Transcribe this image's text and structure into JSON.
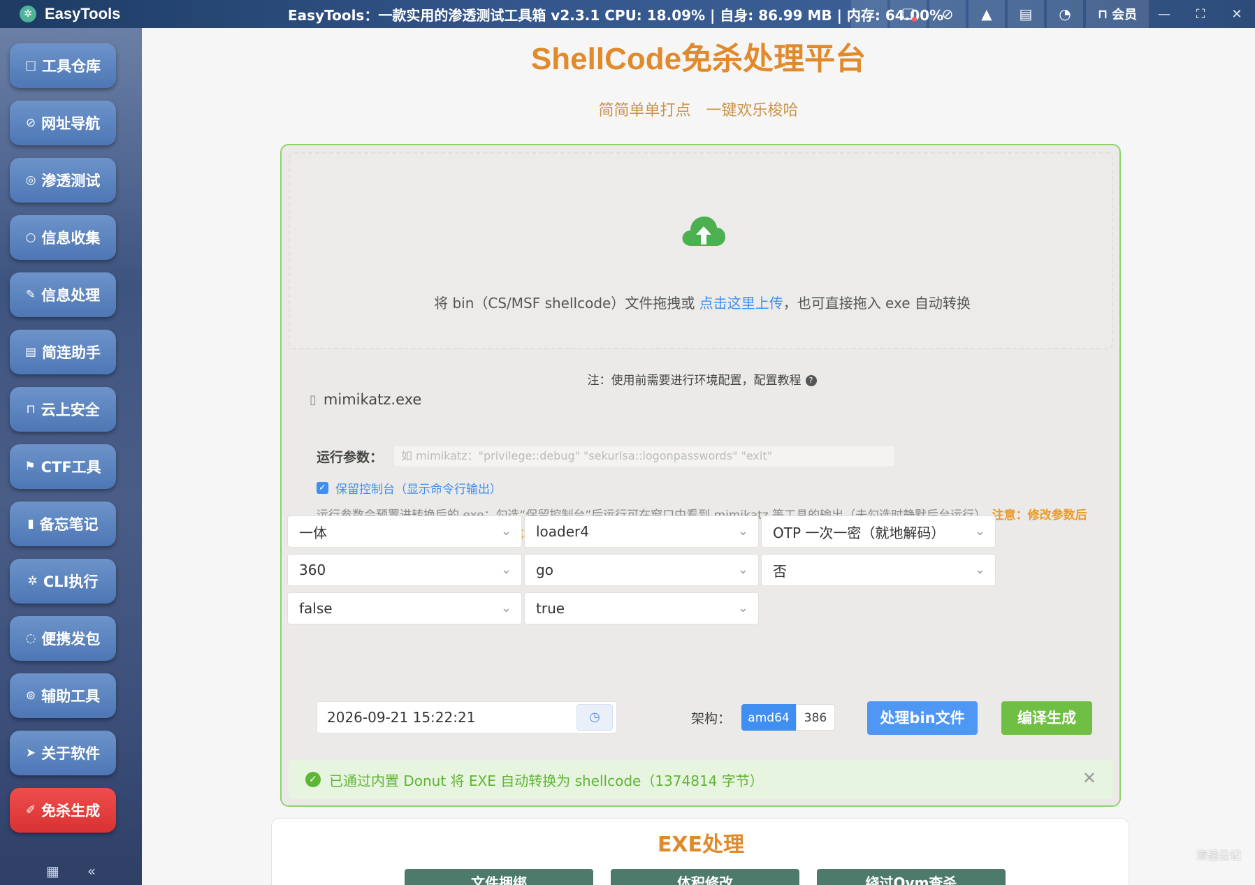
{
  "app": {
    "name": "EasyTools",
    "logo_icon": "gear-icon"
  },
  "status_text": "EasyTools：一款实用的渗透测试工具箱 v2.3.1 CPU: 18.09% | 自身: 86.99 MB | 内存: 64.00%",
  "toolbar": {
    "icons": [
      "search-icon",
      "chat-icon",
      "link-icon",
      "warning-icon",
      "document-icon",
      "speed-icon"
    ],
    "vip_label": "会员"
  },
  "sidebar": {
    "items": [
      {
        "label": "工具仓库",
        "icon": "□"
      },
      {
        "label": "网址导航",
        "icon": "⊘"
      },
      {
        "label": "渗透测试",
        "icon": "◎"
      },
      {
        "label": "信息收集",
        "icon": "○"
      },
      {
        "label": "信息处理",
        "icon": "✎"
      },
      {
        "label": "简连助手",
        "icon": "▤"
      },
      {
        "label": "云上安全",
        "icon": "⊓"
      },
      {
        "label": "CTF工具",
        "icon": "⚑"
      },
      {
        "label": "备忘笔记",
        "icon": "▮"
      },
      {
        "label": "CLI执行",
        "icon": "✲"
      },
      {
        "label": "便携发包",
        "icon": "◌"
      },
      {
        "label": "辅助工具",
        "icon": "⊚"
      },
      {
        "label": "关于软件",
        "icon": "➤"
      },
      {
        "label": "免杀生成",
        "icon": "✐"
      }
    ]
  },
  "main": {
    "title": "ShellCode免杀处理平台",
    "subtitle": "简简单单打点　一键欢乐梭哈",
    "drop_text_pre": "将 bin（CS/MSF shellcode）文件拖拽或 ",
    "drop_link": "点击这里上传",
    "drop_text_post": "，也可直接拖入 exe 自动转换",
    "note": "注：使用前需要进行环境配置，配置教程",
    "file_name": "mimikatz.exe",
    "param_label": "运行参数：",
    "param_placeholder": "如 mimikatz：\"privilege::debug\" \"sekurlsa::logonpasswords\" \"exit\"",
    "keep_console": "保留控制台（显示命令行输出）",
    "desc_normal": "运行参数会预置进转换后的 exe；勾选“保留控制台”后运行可在窗口中看到 mimikatz 等工具的输出（未勾选时静默后台运行）。",
    "desc_warn": "注意：修改参数后必须重新点击“处理bin文件/预处理”再生成，否则仍使用上一次转换的无参载荷",
    "selects": [
      "一体",
      "loader4",
      "OTP 一次一密（就地解码）",
      "360",
      "go",
      "否",
      "false",
      "true"
    ],
    "datetime": "2026-09-21 15:22:21",
    "arch_label": "架构：",
    "arch_options": [
      "amd64",
      "386"
    ],
    "process_btn": "处理bin文件",
    "compile_btn": "编译生成",
    "alert": "已通过内置 Donut 将 EXE 自动转换为 shellcode（1374814 字节）",
    "exe_title": "EXE处理",
    "exe_tabs": [
      "文件捆绑",
      "体积修改",
      "绕过Qvm查杀"
    ],
    "watermark": "渗透云记"
  }
}
